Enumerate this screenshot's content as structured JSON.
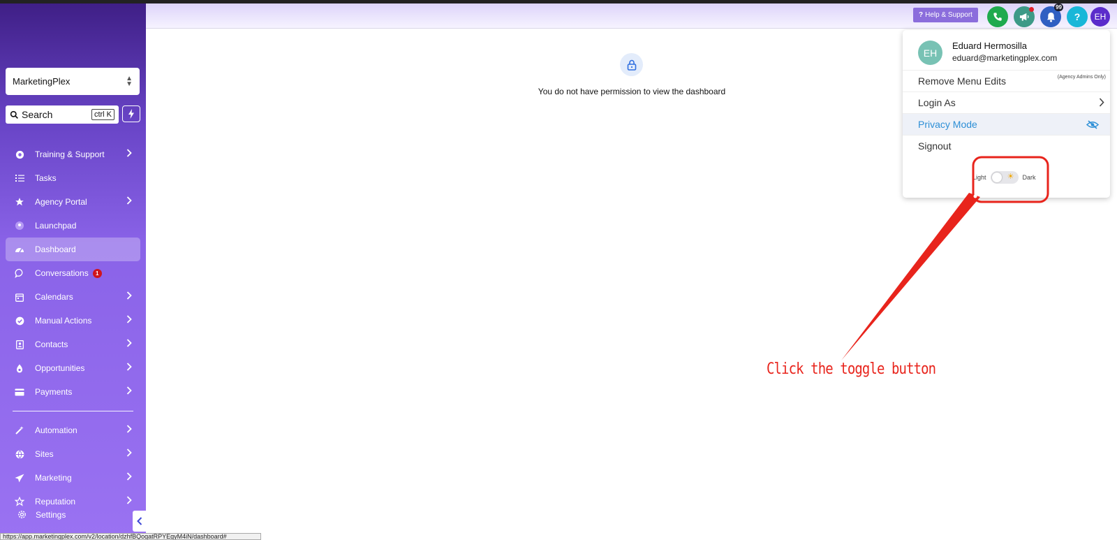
{
  "sidebar": {
    "account": "MarketingPlex",
    "search_label": "Search",
    "search_shortcut": "ctrl K",
    "items": [
      {
        "label": "Training & Support",
        "icon": "lifebuoy-icon",
        "arrow": true
      },
      {
        "label": "Tasks",
        "icon": "list-icon",
        "arrow": false
      },
      {
        "label": "Agency Portal",
        "icon": "star-icon",
        "arrow": true
      },
      {
        "label": "Launchpad",
        "icon": "rocket-icon",
        "arrow": false
      },
      {
        "label": "Dashboard",
        "icon": "gauge-icon",
        "arrow": false,
        "active": true
      },
      {
        "label": "Conversations",
        "icon": "chat-icon",
        "arrow": false,
        "badge": "1"
      },
      {
        "label": "Calendars",
        "icon": "calendar-icon",
        "arrow": true
      },
      {
        "label": "Manual Actions",
        "icon": "check-circle-icon",
        "arrow": true
      },
      {
        "label": "Contacts",
        "icon": "contact-card-icon",
        "arrow": true
      },
      {
        "label": "Opportunities",
        "icon": "funnel-icon",
        "arrow": true
      },
      {
        "label": "Payments",
        "icon": "credit-card-icon",
        "arrow": true
      }
    ],
    "items2": [
      {
        "label": "Automation",
        "icon": "magic-wand-icon",
        "arrow": true
      },
      {
        "label": "Sites",
        "icon": "globe-icon",
        "arrow": true
      },
      {
        "label": "Marketing",
        "icon": "paper-plane-icon",
        "arrow": true
      },
      {
        "label": "Reputation",
        "icon": "star-outline-icon",
        "arrow": true
      }
    ],
    "settings": "Settings"
  },
  "status_url": "https://app.marketingplex.com/v2/location/dzhfBQogatRPYEgyM4iN/dashboard#",
  "header": {
    "help_label": "Help & Support",
    "notification_count": "99",
    "avatar_initials": "EH",
    "colors": {
      "phone": "#1faa4e",
      "megaphone": "#3d9a87",
      "bell": "#2f5fc2",
      "help": "#19b7d8",
      "avatar": "#5b2ccb"
    }
  },
  "main": {
    "permission_message": "You do not have permission to view the dashboard"
  },
  "user_menu": {
    "initials": "EH",
    "name": "Eduard Hermosilla",
    "email": "eduard@marketingplex.com",
    "remove_menu_edits": "Remove Menu Edits",
    "agency_note": "(Agency Admins Only)",
    "login_as": "Login As",
    "privacy_mode": "Privacy Mode",
    "signout": "Signout",
    "theme_light": "Light",
    "theme_dark": "Dark"
  },
  "annotation": {
    "text": "Click the toggle button",
    "color": "#e8241c"
  }
}
